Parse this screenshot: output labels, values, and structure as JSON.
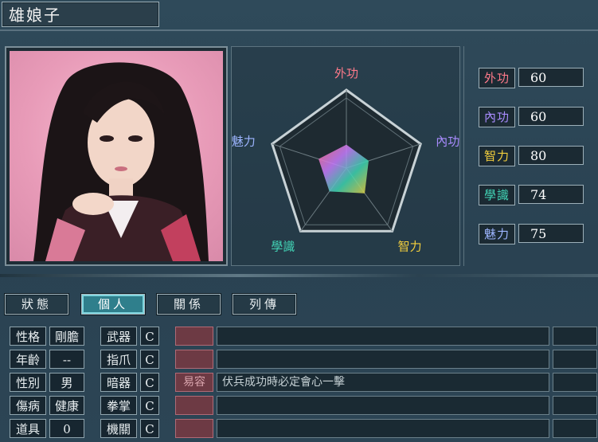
{
  "character": {
    "name": "雄娘子"
  },
  "radar": {
    "axes": [
      "外功",
      "內功",
      "智力",
      "學識",
      "魅力"
    ],
    "values": [
      60,
      60,
      80,
      74,
      75
    ],
    "max": 100
  },
  "stats": [
    {
      "label": "外功",
      "value": "60",
      "color": "#ff7a8a"
    },
    {
      "label": "內功",
      "value": "60",
      "color": "#a98cff"
    },
    {
      "label": "智力",
      "value": "80",
      "color": "#f3cf3d"
    },
    {
      "label": "學識",
      "value": "74",
      "color": "#42d6b7"
    },
    {
      "label": "魅力",
      "value": "75",
      "color": "#9db5ff"
    }
  ],
  "tabs": [
    {
      "label": "狀態",
      "active": false
    },
    {
      "label": "個人",
      "active": true
    },
    {
      "label": "關係",
      "active": false
    },
    {
      "label": "列傳",
      "active": false
    }
  ],
  "personal": [
    {
      "label": "性格",
      "value": "剛膽"
    },
    {
      "label": "年齡",
      "value": "--"
    },
    {
      "label": "性別",
      "value": "男"
    },
    {
      "label": "傷病",
      "value": "健康"
    },
    {
      "label": "道具",
      "value": "0"
    }
  ],
  "skills": [
    {
      "label": "武器",
      "grade": "C",
      "slot": "",
      "desc": ""
    },
    {
      "label": "指爪",
      "grade": "C",
      "slot": "",
      "desc": ""
    },
    {
      "label": "暗器",
      "grade": "C",
      "slot": "易容",
      "desc": "伏兵成功時必定會心一擊"
    },
    {
      "label": "拳掌",
      "grade": "C",
      "slot": "",
      "desc": ""
    },
    {
      "label": "機關",
      "grade": "C",
      "slot": "",
      "desc": ""
    }
  ]
}
